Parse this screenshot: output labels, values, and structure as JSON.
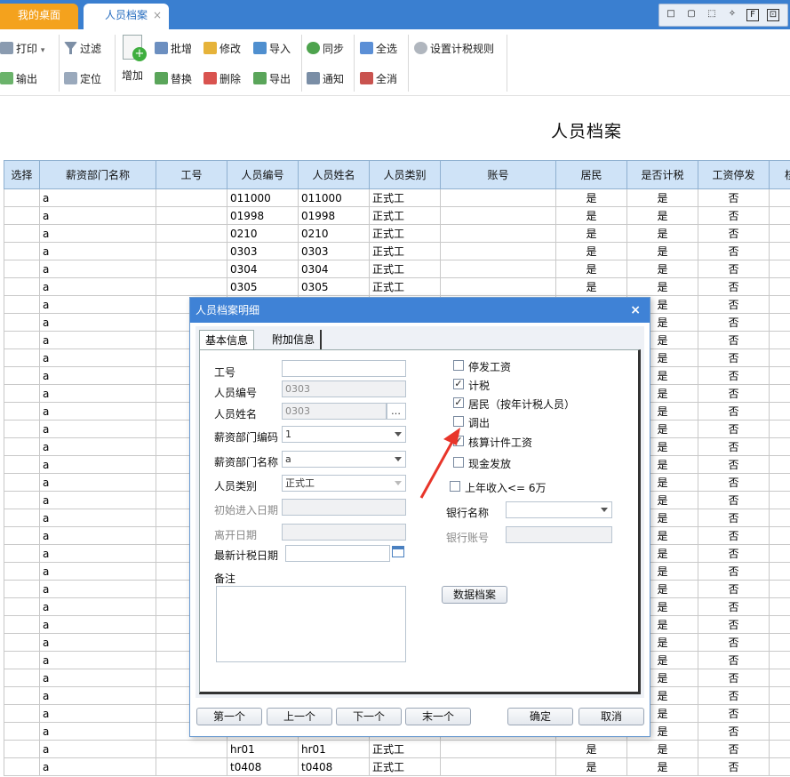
{
  "tabs": {
    "home": "我的桌面",
    "active": "人员档案",
    "close": "×"
  },
  "window_buttons": [
    "□",
    "▢",
    "⬚",
    "✧",
    "F",
    "⊡"
  ],
  "toolbar": {
    "print": "打印",
    "export_out": "输出",
    "filter": "过滤",
    "locate": "定位",
    "add": "增加",
    "batch_add": "批增",
    "replace": "替换",
    "modify": "修改",
    "delete": "删除",
    "import": "导入",
    "export": "导出",
    "sync": "同步",
    "notify": "通知",
    "select_all": "全选",
    "deselect_all": "全消",
    "tax_rules": "设置计税规则"
  },
  "page_title": "人员档案",
  "table": {
    "columns": [
      "选择",
      "薪资部门名称",
      "工号",
      "人员编号",
      "人员姓名",
      "人员类别",
      "账号",
      "居民",
      "是否计税",
      "工资停发",
      "核算"
    ],
    "rows": [
      [
        "",
        "a",
        "",
        "011000",
        "011000",
        "正式工",
        "",
        "是",
        "是",
        "否",
        ""
      ],
      [
        "",
        "a",
        "",
        "01998",
        "01998",
        "正式工",
        "",
        "是",
        "是",
        "否",
        ""
      ],
      [
        "",
        "a",
        "",
        "0210",
        "0210",
        "正式工",
        "",
        "是",
        "是",
        "否",
        ""
      ],
      [
        "",
        "a",
        "",
        "0303",
        "0303",
        "正式工",
        "",
        "是",
        "是",
        "否",
        ""
      ],
      [
        "",
        "a",
        "",
        "0304",
        "0304",
        "正式工",
        "",
        "是",
        "是",
        "否",
        ""
      ],
      [
        "",
        "a",
        "",
        "0305",
        "0305",
        "正式工",
        "",
        "是",
        "是",
        "否",
        ""
      ],
      [
        "",
        "a",
        "",
        "",
        "",
        "",
        "",
        "",
        "是",
        "否",
        ""
      ],
      [
        "",
        "a",
        "",
        "",
        "",
        "",
        "",
        "",
        "是",
        "否",
        ""
      ],
      [
        "",
        "a",
        "",
        "",
        "",
        "",
        "",
        "",
        "是",
        "否",
        ""
      ],
      [
        "",
        "a",
        "",
        "",
        "",
        "",
        "",
        "",
        "是",
        "否",
        ""
      ],
      [
        "",
        "a",
        "",
        "",
        "",
        "",
        "",
        "",
        "是",
        "否",
        ""
      ],
      [
        "",
        "a",
        "",
        "",
        "",
        "",
        "",
        "",
        "是",
        "否",
        ""
      ],
      [
        "",
        "a",
        "",
        "",
        "",
        "",
        "",
        "",
        "是",
        "否",
        ""
      ],
      [
        "",
        "a",
        "",
        "",
        "",
        "",
        "",
        "",
        "是",
        "否",
        ""
      ],
      [
        "",
        "a",
        "",
        "",
        "",
        "",
        "",
        "",
        "是",
        "否",
        ""
      ],
      [
        "",
        "a",
        "",
        "",
        "",
        "",
        "",
        "",
        "是",
        "否",
        ""
      ],
      [
        "",
        "a",
        "",
        "",
        "",
        "",
        "",
        "",
        "是",
        "否",
        ""
      ],
      [
        "",
        "a",
        "",
        "",
        "",
        "",
        "",
        "",
        "是",
        "否",
        ""
      ],
      [
        "",
        "a",
        "",
        "",
        "",
        "",
        "",
        "",
        "是",
        "否",
        ""
      ],
      [
        "",
        "a",
        "",
        "",
        "",
        "",
        "",
        "",
        "是",
        "否",
        ""
      ],
      [
        "",
        "a",
        "",
        "",
        "",
        "",
        "",
        "",
        "是",
        "否",
        ""
      ],
      [
        "",
        "a",
        "",
        "",
        "",
        "",
        "",
        "",
        "是",
        "否",
        ""
      ],
      [
        "",
        "a",
        "",
        "",
        "",
        "",
        "",
        "",
        "是",
        "否",
        ""
      ],
      [
        "",
        "a",
        "",
        "",
        "",
        "",
        "",
        "",
        "是",
        "否",
        ""
      ],
      [
        "",
        "a",
        "",
        "",
        "",
        "",
        "",
        "",
        "是",
        "否",
        ""
      ],
      [
        "",
        "a",
        "",
        "",
        "",
        "",
        "",
        "",
        "是",
        "否",
        ""
      ],
      [
        "",
        "a",
        "",
        "",
        "",
        "",
        "",
        "",
        "是",
        "否",
        ""
      ],
      [
        "",
        "a",
        "",
        "",
        "",
        "",
        "",
        "",
        "是",
        "否",
        ""
      ],
      [
        "",
        "a",
        "",
        "",
        "",
        "",
        "",
        "",
        "是",
        "否",
        ""
      ],
      [
        "",
        "a",
        "",
        "",
        "",
        "",
        "",
        "",
        "是",
        "否",
        ""
      ],
      [
        "",
        "a",
        "",
        "",
        "",
        "",
        "",
        "",
        "是",
        "否",
        ""
      ],
      [
        "",
        "a",
        "",
        "hr01",
        "hr01",
        "正式工",
        "",
        "是",
        "是",
        "否",
        ""
      ],
      [
        "",
        "a",
        "",
        "t0408",
        "t0408",
        "正式工",
        "",
        "是",
        "是",
        "否",
        ""
      ]
    ]
  },
  "dialog": {
    "title": "人员档案明细",
    "close": "×",
    "tab_basic": "基本信息",
    "tab_extra": "附加信息",
    "label_id": "工号",
    "label_emp_no": "人员编号",
    "emp_no": "0303",
    "label_name": "人员姓名",
    "name": "0303",
    "ellipsis": "…",
    "label_dept_code": "薪资部门编码",
    "dept_code": "1",
    "label_dept_name": "薪资部门名称",
    "dept_name": "a",
    "label_category": "人员类别",
    "category": "正式工",
    "label_entry_date": "初始进入日期",
    "label_leave_date": "离开日期",
    "label_tax_date": "最新计税日期",
    "label_remark": "备注",
    "checks": [
      {
        "label": "停发工资",
        "checked": false
      },
      {
        "label": "计税",
        "checked": true
      },
      {
        "label": "居民（按年计税人员）",
        "checked": true
      },
      {
        "label": "调出",
        "checked": false
      },
      {
        "label": "核算计件工资",
        "checked": true
      },
      {
        "label": "现金发放",
        "checked": false
      },
      {
        "label": "上年收入<= 6万",
        "checked": false
      }
    ],
    "check_mark": "✓",
    "label_bank_name": "银行名称",
    "label_bank_account": "银行账号",
    "data_archive_btn": "数据档案",
    "btn_first": "第一个",
    "btn_prev": "上一个",
    "btn_next": "下一个",
    "btn_last": "末一个",
    "btn_ok": "确定",
    "btn_cancel": "取消"
  },
  "colors": {
    "header_blue": "#3a7fd0",
    "home_tab": "#f4a21d",
    "grid_header": "#cfe3f7",
    "arrow": "#e8352a"
  }
}
